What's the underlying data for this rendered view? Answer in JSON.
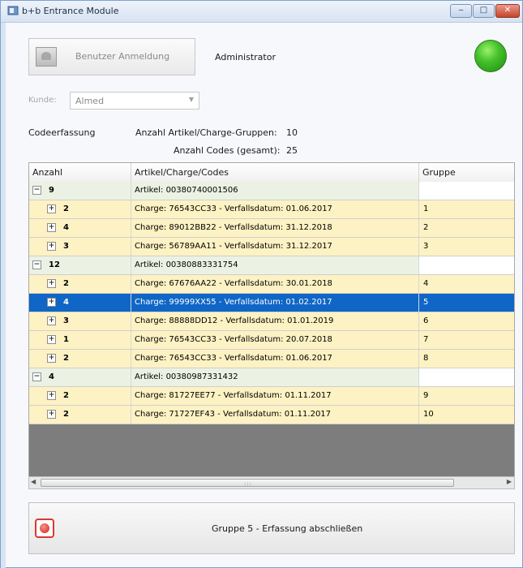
{
  "window": {
    "title": "b+b Entrance Module",
    "controls": {
      "minimize": "‒",
      "maximize": "□",
      "close": "✕"
    }
  },
  "header": {
    "login_button_label": "Benutzer Anmeldung",
    "user_name": "Administrator",
    "status_light_color": "#3cb82a"
  },
  "kunde": {
    "label": "Kunde:",
    "selected": "Almed"
  },
  "stats": {
    "section_label": "Codeerfassung",
    "groups_label": "Anzahl Artikel/Charge-Gruppen:",
    "groups_value": "10",
    "codes_label": "Anzahl Codes (gesamt):",
    "codes_value": "25"
  },
  "grid": {
    "columns": [
      "Anzahl",
      "Artikel/Charge/Codes",
      "Gruppe"
    ],
    "rows": [
      {
        "type": "group",
        "expander": "−",
        "count": "9",
        "text": "Artikel: 00380740001506",
        "gruppe": ""
      },
      {
        "type": "child",
        "expander": "+",
        "count": "2",
        "text": "Charge: 76543CC33  -  Verfallsdatum: 01.06.2017",
        "gruppe": "1"
      },
      {
        "type": "child",
        "expander": "+",
        "count": "4",
        "text": "Charge: 89012BB22  -  Verfallsdatum: 31.12.2018",
        "gruppe": "2"
      },
      {
        "type": "child",
        "expander": "+",
        "count": "3",
        "text": "Charge: 56789AA11  -  Verfallsdatum: 31.12.2017",
        "gruppe": "3"
      },
      {
        "type": "group",
        "expander": "−",
        "count": "12",
        "text": "Artikel: 00380883331754",
        "gruppe": ""
      },
      {
        "type": "child",
        "expander": "+",
        "count": "2",
        "text": "Charge: 67676AA22  -  Verfallsdatum: 30.01.2018",
        "gruppe": "4"
      },
      {
        "type": "selected",
        "expander": "+",
        "count": "4",
        "text": "Charge: 99999XX55  -  Verfallsdatum: 01.02.2017",
        "gruppe": "5"
      },
      {
        "type": "child",
        "expander": "+",
        "count": "3",
        "text": "Charge: 88888DD12  -  Verfallsdatum: 01.01.2019",
        "gruppe": "6"
      },
      {
        "type": "child",
        "expander": "+",
        "count": "1",
        "text": "Charge: 76543CC33  -  Verfallsdatum: 20.07.2018",
        "gruppe": "7"
      },
      {
        "type": "child",
        "expander": "+",
        "count": "2",
        "text": "Charge: 76543CC33  -  Verfallsdatum: 01.06.2017",
        "gruppe": "8"
      },
      {
        "type": "group",
        "expander": "−",
        "count": "4",
        "text": "Artikel: 00380987331432",
        "gruppe": ""
      },
      {
        "type": "child",
        "expander": "+",
        "count": "2",
        "text": "Charge: 81727EE77  -  Verfallsdatum: 01.11.2017",
        "gruppe": "9"
      },
      {
        "type": "child",
        "expander": "+",
        "count": "2",
        "text": "Charge: 71727EF43  -  Verfallsdatum: 01.11.2017",
        "gruppe": "10"
      }
    ]
  },
  "footer": {
    "finish_label": "Gruppe 5 - Erfassung abschließen"
  }
}
